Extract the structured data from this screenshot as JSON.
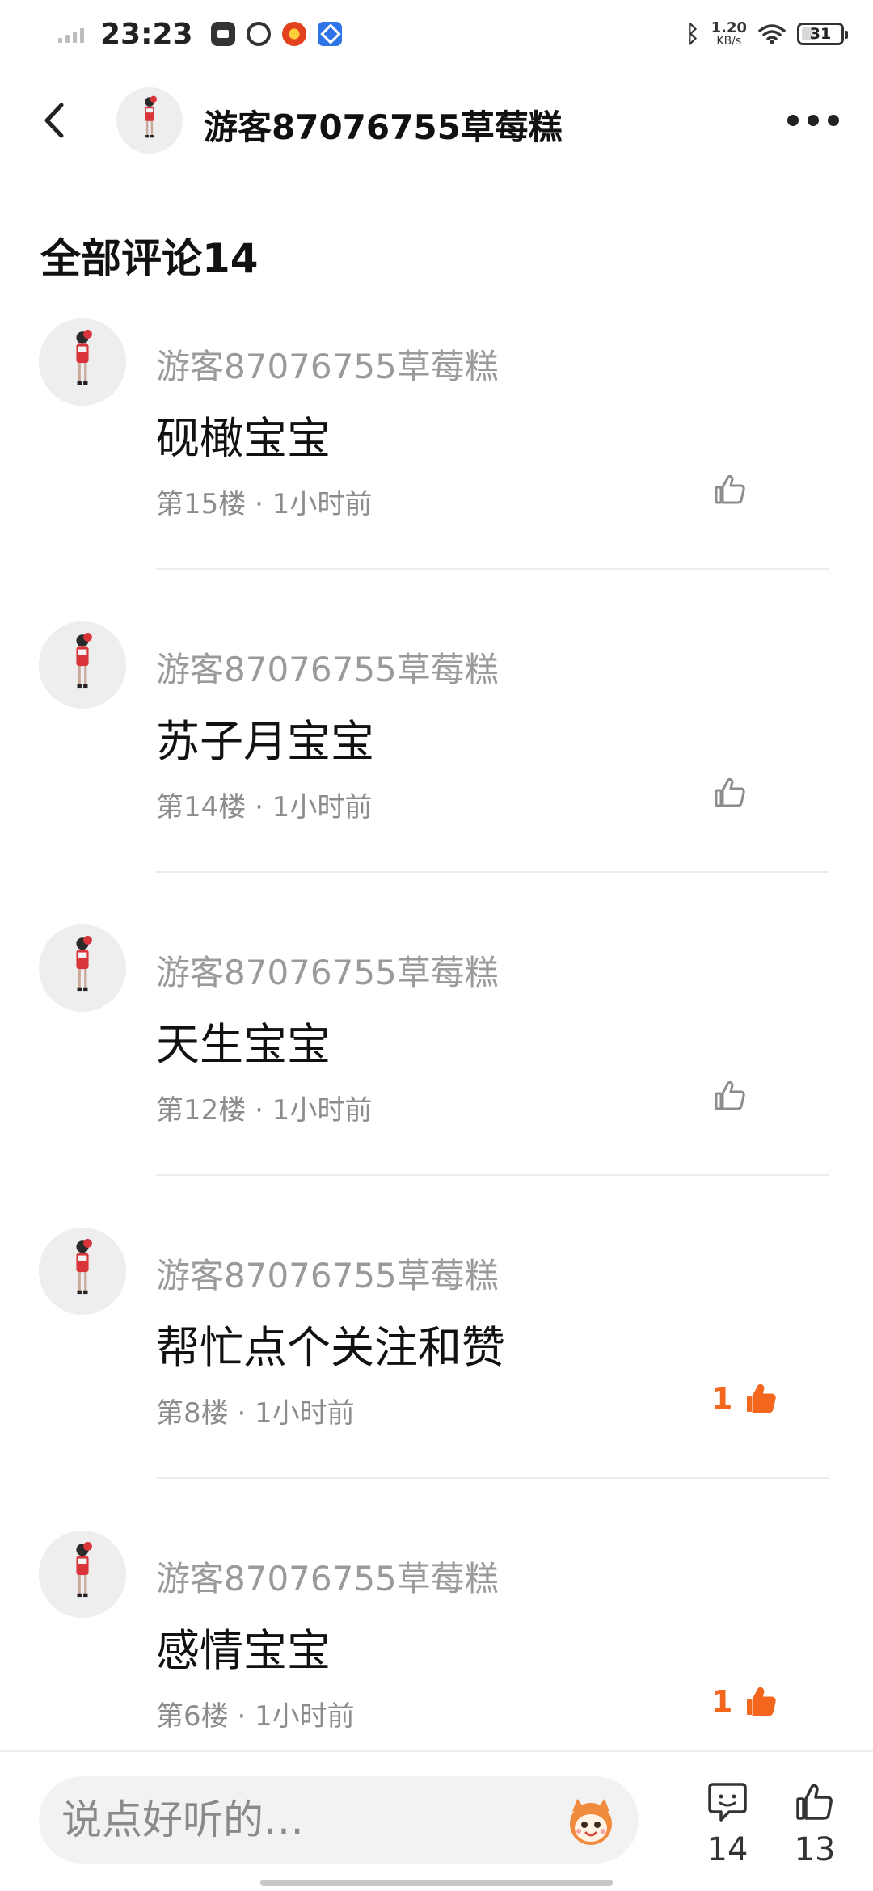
{
  "status_bar": {
    "time": "23:23",
    "network_speed_value": "1.20",
    "network_speed_unit": "KB/s",
    "battery": "31",
    "icons": [
      "signal-icon",
      "app-notification-icon",
      "ring-app-icon",
      "red-app-icon",
      "blue-app-icon",
      "bluetooth-icon",
      "wifi-icon",
      "battery-icon"
    ]
  },
  "header": {
    "user_name": "游客87076755草莓糕",
    "back_icon": "chevron-left-icon",
    "more_icon": "more-dots-icon"
  },
  "section": {
    "title": "全部评论14"
  },
  "comments": [
    {
      "author": "游客87076755草莓糕",
      "text": "砚橄宝宝",
      "meta": "第15楼 · 1小时前",
      "likes": "",
      "liked": false
    },
    {
      "author": "游客87076755草莓糕",
      "text": "苏子月宝宝",
      "meta": "第14楼 · 1小时前",
      "likes": "",
      "liked": false
    },
    {
      "author": "游客87076755草莓糕",
      "text": "天生宝宝",
      "meta": "第12楼 · 1小时前",
      "likes": "",
      "liked": false
    },
    {
      "author": "游客87076755草莓糕",
      "text": "帮忙点个关注和赞",
      "meta": "第8楼 · 1小时前",
      "likes": "1",
      "liked": true
    },
    {
      "author": "游客87076755草莓糕",
      "text": "感情宝宝",
      "meta": "第6楼 · 1小时前",
      "likes": "1",
      "liked": true
    }
  ],
  "bottom_bar": {
    "input_placeholder": "说点好听的…",
    "comment_count": "14",
    "like_count": "13"
  },
  "colors": {
    "accent": "#f2661e",
    "muted_text": "#9a9a9a",
    "divider": "#ececec"
  }
}
